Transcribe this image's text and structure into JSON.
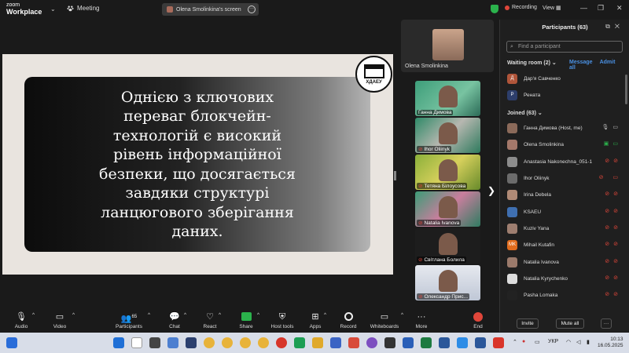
{
  "app": {
    "logo_line1": "zoom",
    "logo_line2": "Workplace",
    "meeting_label": "Meeting"
  },
  "screen_share": {
    "label": "Olena Smolinkina's screen"
  },
  "status": {
    "recording": "Recording",
    "view": "View"
  },
  "slide": {
    "text": "Однією з ключових\nпереваг блокчейн-\nтехнологій є високий\nрівень інформаційної\nбезпеки, що досягається\nзавдяки структурі\nланцюгового зберігання\nданих.",
    "logo_text": "ХДАЕУ"
  },
  "active_speaker": {
    "name": "Olena Smolinkina"
  },
  "gallery": [
    {
      "name": "Ганна Димова",
      "muted": false
    },
    {
      "name": "Ihor Oliinyk",
      "muted": true
    },
    {
      "name": "Тетяна Білоусова",
      "muted": true
    },
    {
      "name": "Natalia Ivanova",
      "muted": true
    },
    {
      "name": "Світлана Болила",
      "muted": true
    },
    {
      "name": "Олександр Прис...",
      "muted": true
    }
  ],
  "panel": {
    "title": "Participants (63)",
    "search_placeholder": "Find a participant",
    "waiting_room": "Waiting room (2)",
    "message": "Message",
    "admit_all": "Admit all",
    "waiting": [
      {
        "initial": "Д",
        "name": "Дар'я Савченко",
        "color": "#b0553a"
      },
      {
        "initial": "Р",
        "name": "Рената",
        "color": "#2d3e6b"
      }
    ],
    "joined": "Joined (63)",
    "participants": [
      {
        "name": "Ганна Димова (Host, me)",
        "initial": "",
        "color": "#8b6a5a"
      },
      {
        "name": "Olena Smolinkina",
        "initial": "",
        "color": "#a4786a"
      },
      {
        "name": "Anastasia Nakonechna_051-1",
        "initial": "",
        "color": "#8c8c8c"
      },
      {
        "name": "Ihor Oliinyk",
        "initial": "",
        "color": "#6b6b6b"
      },
      {
        "name": "Irina Debela",
        "initial": "",
        "color": "#b08a76"
      },
      {
        "name": "KSAEU",
        "initial": "",
        "color": "#3f6fb0"
      },
      {
        "name": "Kuziv Yana",
        "initial": "",
        "color": "#9e7e70"
      },
      {
        "name": "Mihail Kutafin",
        "initial": "MK",
        "color": "#e06c1d"
      },
      {
        "name": "Natalia Ivanova",
        "initial": "",
        "color": "#9b7a6b"
      },
      {
        "name": "Natalia Kyrychenko",
        "initial": "",
        "color": "#ddd"
      },
      {
        "name": "Pasha Lomaka",
        "initial": "",
        "color": "#222"
      }
    ],
    "invite": "Invite",
    "mute_all": "Mute all",
    "more": "···"
  },
  "toolbar": {
    "audio": "Audio",
    "video": "Video",
    "participants": "Participants",
    "participants_count": "65",
    "chat": "Chat",
    "react": "React",
    "share": "Share",
    "host_tools": "Host tools",
    "apps": "Apps",
    "record": "Record",
    "whiteboards": "Whiteboards",
    "more": "More",
    "end": "End"
  },
  "taskbar": {
    "lang": "УКР",
    "time": "10:13",
    "date": "16.05.2025"
  }
}
